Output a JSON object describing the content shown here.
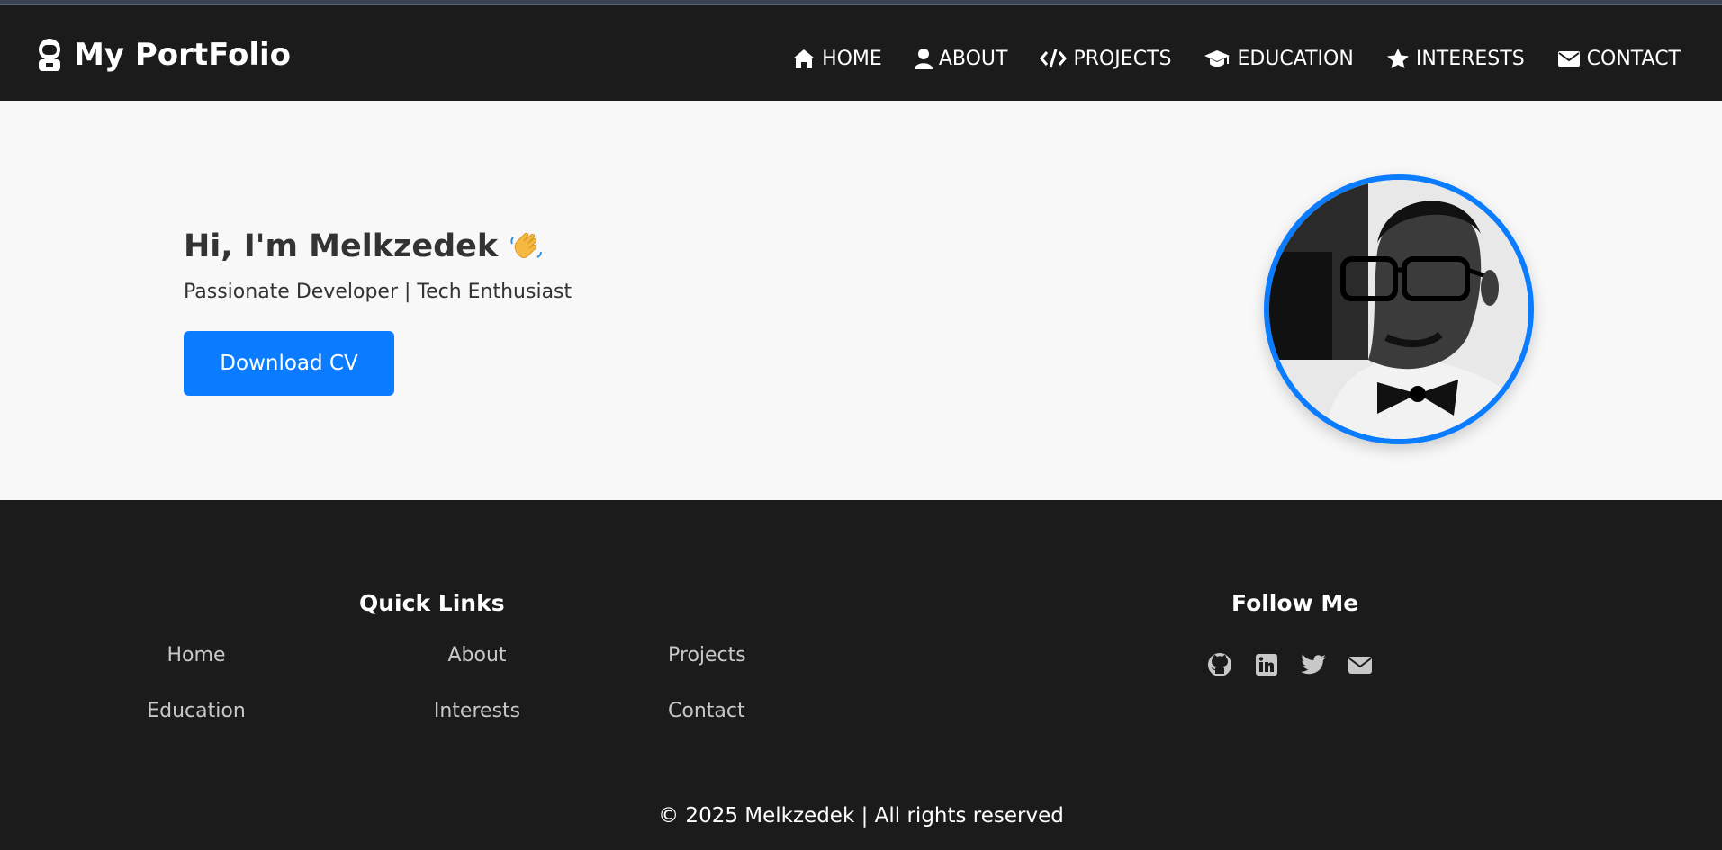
{
  "brand": {
    "title": "My PortFolio",
    "icon": "astronaut-icon"
  },
  "nav": {
    "items": [
      {
        "label": "HOME",
        "icon": "home-icon"
      },
      {
        "label": "ABOUT",
        "icon": "user-icon"
      },
      {
        "label": "PROJECTS",
        "icon": "code-icon"
      },
      {
        "label": "EDUCATION",
        "icon": "graduation-cap-icon"
      },
      {
        "label": "INTERESTS",
        "icon": "star-icon"
      },
      {
        "label": "CONTACT",
        "icon": "envelope-icon"
      }
    ]
  },
  "hero": {
    "title": "Hi, I'm Melkzedek",
    "subtitle": "Passionate Developer | Tech Enthusiast",
    "cv_button": "Download CV"
  },
  "footer": {
    "quick_links_title": "Quick Links",
    "quick_links": [
      "Home",
      "About",
      "Projects",
      "Education",
      "Interests",
      "Contact"
    ],
    "follow_title": "Follow Me",
    "social": [
      "github-icon",
      "linkedin-icon",
      "twitter-icon",
      "envelope-icon"
    ],
    "copyright": "© 2025 Melkzedek | All rights reserved"
  },
  "colors": {
    "accent": "#0a7cff",
    "dark": "#1b1b1b",
    "hero_bg": "#f8f8f8"
  }
}
